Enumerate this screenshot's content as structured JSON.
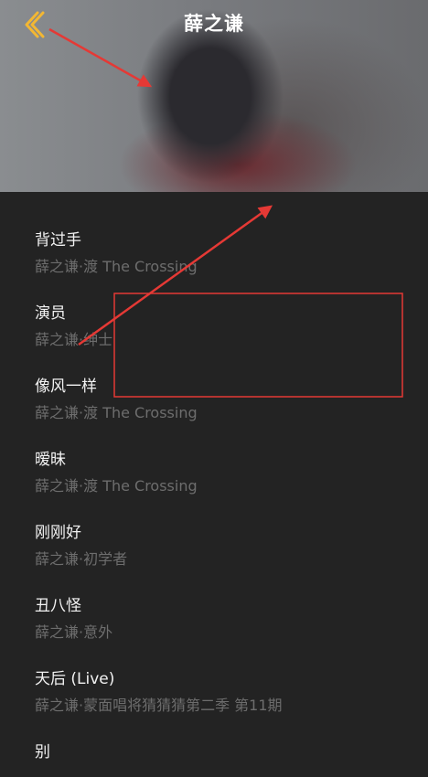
{
  "header": {
    "title": "薛之谦",
    "back_icon": "chevron-left-icon",
    "accent_color": "#f3b733"
  },
  "songs": [
    {
      "title": "背过手",
      "subtitle": "薛之谦·渡 The Crossing"
    },
    {
      "title": "演员",
      "subtitle": "薛之谦·绅士"
    },
    {
      "title": "像风一样",
      "subtitle": "薛之谦·渡 The Crossing"
    },
    {
      "title": "暧昧",
      "subtitle": "薛之谦·渡 The Crossing"
    },
    {
      "title": "刚刚好",
      "subtitle": "薛之谦·初学者"
    },
    {
      "title": "丑八怪",
      "subtitle": "薛之谦·意外"
    },
    {
      "title": "天后 (Live)",
      "subtitle": "薛之谦·蒙面唱将猜猜猜第二季 第11期"
    },
    {
      "title": "别",
      "subtitle": ""
    }
  ],
  "annotation_color": "#e53935"
}
